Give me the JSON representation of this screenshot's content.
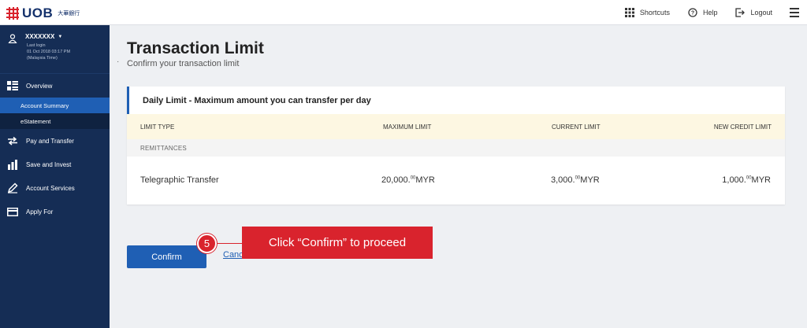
{
  "brand": {
    "name": "UOB",
    "chinese": "大華銀行",
    "color": "#d9232d"
  },
  "topbar": {
    "shortcuts": {
      "label": "Shortcuts",
      "icon": "grid-icon"
    },
    "help": {
      "label": "Help",
      "icon": "help-icon"
    },
    "logout": {
      "label": "Logout",
      "icon": "logout-icon"
    },
    "menu_icon": "hamburger-icon"
  },
  "sidebar": {
    "user": {
      "name": "XXXXXXX",
      "last_login_label": "Last login",
      "last_login_time": "01 Oct 2018 03:17 PM",
      "timezone": "(Malaysia Time)"
    },
    "items": [
      {
        "label": "Overview",
        "icon": "overview-icon"
      },
      {
        "label": "Account Summary"
      },
      {
        "label": "eStatement"
      },
      {
        "label": "Pay and Transfer",
        "icon": "transfer-icon"
      },
      {
        "label": "Save and Invest",
        "icon": "invest-icon"
      },
      {
        "label": "Account Services",
        "icon": "pencil-icon"
      },
      {
        "label": "Apply For",
        "icon": "card-icon"
      }
    ]
  },
  "main": {
    "title": "Transaction Limit",
    "subtitle": "Confirm your transaction limit",
    "card": {
      "header": "Daily Limit - Maximum amount you can transfer per day",
      "columns": [
        "LIMIT TYPE",
        "MAXIMUM LIMIT",
        "CURRENT LIMIT",
        "NEW CREDIT LIMIT"
      ],
      "section": "REMITTANCES",
      "row": {
        "type": "Telegraphic Transfer",
        "max_whole": "20,000.",
        "max_cents": "00",
        "max_currency": "MYR",
        "current_whole": "3,000.",
        "current_cents": "00",
        "current_currency": "MYR",
        "new_whole": "1,000.",
        "new_cents": "00",
        "new_currency": "MYR"
      }
    },
    "confirm_label": "Confirm",
    "cancel_label": "Cancel"
  },
  "callout": {
    "step": "5",
    "text": "Click “Confirm” to proceed"
  },
  "colors": {
    "accent": "#1f5fb4",
    "sidebar": "#152d55",
    "highlight": "#d9232d",
    "table_header": "#fdf7e2"
  }
}
